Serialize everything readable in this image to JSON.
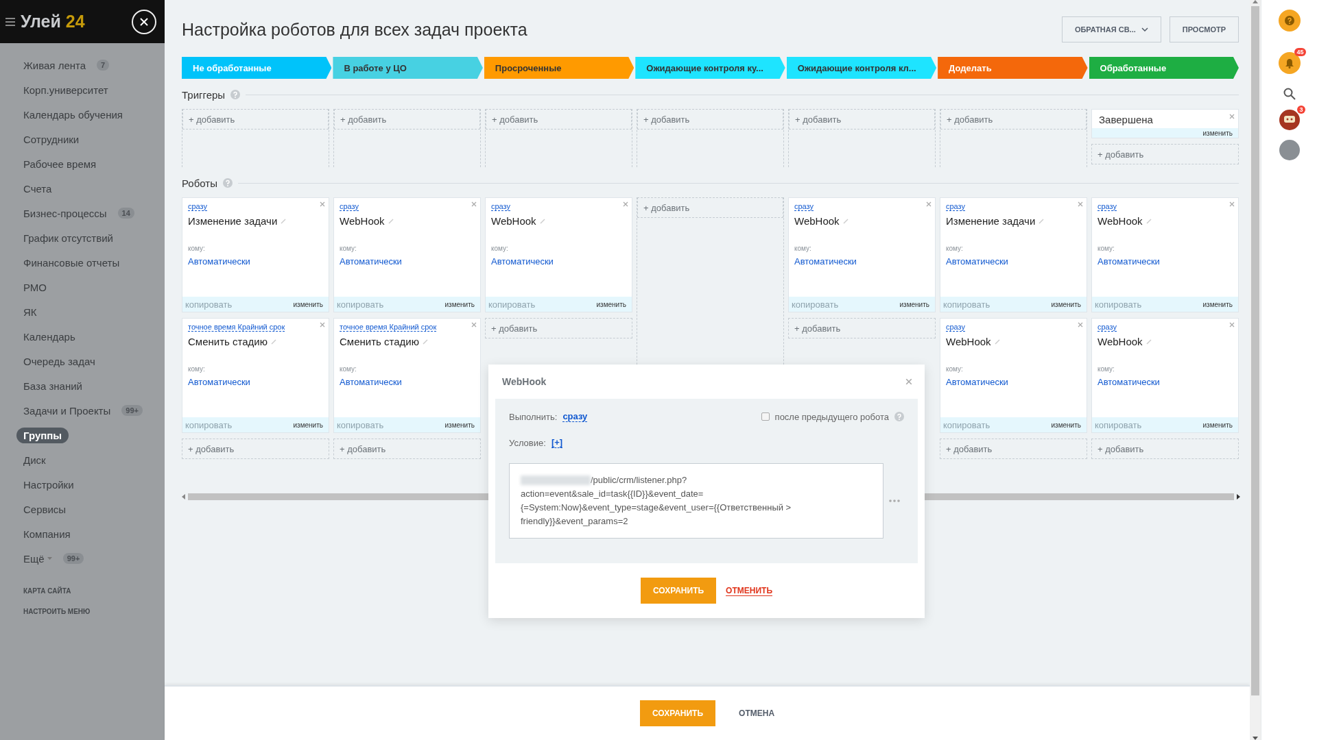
{
  "header": {
    "logo_text": "Улей",
    "logo_number": "24"
  },
  "sidebar": {
    "items": [
      {
        "label": "Живая лента",
        "count": "7",
        "selected": false,
        "dropdown": false
      },
      {
        "label": "Корп.университет",
        "selected": false,
        "dropdown": false
      },
      {
        "label": "Календарь обучения",
        "selected": false,
        "dropdown": false
      },
      {
        "label": "Сотрудники",
        "selected": false,
        "dropdown": false
      },
      {
        "label": "Рабочее время",
        "selected": false,
        "dropdown": false
      },
      {
        "label": "Счета",
        "selected": false,
        "dropdown": false
      },
      {
        "label": "Бизнес-процессы",
        "count": "14",
        "selected": false,
        "dropdown": false
      },
      {
        "label": "График отсутствий",
        "selected": false,
        "dropdown": false
      },
      {
        "label": "Финансовые отчеты",
        "selected": false,
        "dropdown": false
      },
      {
        "label": "РМО",
        "selected": false,
        "dropdown": false
      },
      {
        "label": "ЯК",
        "selected": false,
        "dropdown": false
      },
      {
        "label": "Календарь",
        "selected": false,
        "dropdown": false
      },
      {
        "label": "Очередь задач",
        "selected": false,
        "dropdown": false
      },
      {
        "label": "База знаний",
        "selected": false,
        "dropdown": false
      },
      {
        "label": "Задачи и Проекты",
        "count": "99+",
        "selected": false,
        "dropdown": false
      },
      {
        "label": "Группы",
        "selected": true,
        "dropdown": false
      },
      {
        "label": "Диск",
        "selected": false,
        "dropdown": false
      },
      {
        "label": "Настройки",
        "selected": false,
        "dropdown": false
      },
      {
        "label": "Сервисы",
        "selected": false,
        "dropdown": false
      },
      {
        "label": "Компания",
        "selected": false,
        "dropdown": false
      },
      {
        "label": "Ещё",
        "count": "99+",
        "selected": false,
        "dropdown": true
      }
    ],
    "links": [
      "КАРТА САЙТА",
      "НАСТРОИТЬ МЕНЮ"
    ]
  },
  "page_title": "Настройка роботов для всех задач проекта",
  "header_buttons": [
    {
      "label": "ОБРАТНАЯ СВ...",
      "kind": "dropdown"
    },
    {
      "label": "ПРОСМОТР",
      "kind": "plain"
    }
  ],
  "stages": [
    {
      "label": "Не обработанные",
      "color": "#00c3fa"
    },
    {
      "label": "В работе у ЦО",
      "color": "#47d1e2"
    },
    {
      "label": "Просроченные",
      "color": "#ff9a00"
    },
    {
      "label": "Ожидающие контроля ку...",
      "color": "#1ee4ff"
    },
    {
      "label": "Ожидающие контроля кл...",
      "color": "#1ee4ff"
    },
    {
      "label": "Доделать",
      "color": "#f4680b"
    },
    {
      "label": "Обработанные",
      "color": "#1eae43"
    }
  ],
  "triggers": {
    "title": "Триггеры",
    "columns": [
      {
        "add_label": "+ добавить"
      },
      {
        "add_label": "+ добавить"
      },
      {
        "add_label": "+ добавить"
      },
      {
        "add_label": "+ добавить"
      },
      {
        "add_label": "+ добавить"
      },
      {
        "add_label": "+ добавить"
      },
      {
        "triggers": [
          {
            "name": "Завершена",
            "edit_label": "изменить"
          }
        ],
        "add_label": "+ добавить"
      }
    ]
  },
  "robots": {
    "title": "Роботы",
    "columns": [
      {
        "robots": [
          {
            "when": "сразу",
            "name": "Изменение задачи",
            "to_label": "кому:",
            "to": "Автоматически",
            "copy_label": "копировать",
            "edit_label": "изменить"
          },
          {
            "when": "точное время Крайний срок",
            "name": "Сменить стадию",
            "to_label": "кому:",
            "to": "Автоматически",
            "copy_label": "копировать",
            "edit_label": "изменить"
          }
        ],
        "add_label": "+ добавить"
      },
      {
        "robots": [
          {
            "when": "сразу",
            "name": "WebHook",
            "to_label": "кому:",
            "to": "Автоматически",
            "copy_label": "копировать",
            "edit_label": "изменить"
          },
          {
            "when": "точное время Крайний срок",
            "name": "Сменить стадию",
            "to_label": "кому:",
            "to": "Автоматически",
            "copy_label": "копировать",
            "edit_label": "изменить"
          }
        ],
        "add_label": "+ добавить"
      },
      {
        "robots": [
          {
            "when": "сразу",
            "name": "WebHook",
            "to_label": "кому:",
            "to": "Автоматически",
            "copy_label": "копировать",
            "edit_label": "изменить"
          }
        ],
        "add_label": "+ добавить"
      },
      {
        "add_label": "+ добавить"
      },
      {
        "robots": [
          {
            "when": "сразу",
            "name": "WebHook",
            "to_label": "кому:",
            "to": "Автоматически",
            "copy_label": "копировать",
            "edit_label": "изменить"
          }
        ],
        "add_label": "+ добавить"
      },
      {
        "robots": [
          {
            "when": "сразу",
            "name": "Изменение задачи",
            "to_label": "кому:",
            "to": "Автоматически",
            "copy_label": "копировать",
            "edit_label": "изменить"
          },
          {
            "when": "сразу",
            "name": "WebHook",
            "to_label": "кому:",
            "to": "Автоматически",
            "copy_label": "копировать",
            "edit_label": "изменить"
          }
        ],
        "add_label": "+ добавить"
      },
      {
        "robots": [
          {
            "when": "сразу",
            "name": "WebHook",
            "to_label": "кому:",
            "to": "Автоматически",
            "copy_label": "копировать",
            "edit_label": "изменить"
          },
          {
            "when": "сразу",
            "name": "WebHook",
            "to_label": "кому:",
            "to": "Автоматически",
            "copy_label": "копировать",
            "edit_label": "изменить"
          }
        ],
        "add_label": "+ добавить"
      }
    ]
  },
  "modal": {
    "title": "WebHook",
    "run_label": "Выполнить:",
    "run_value": "сразу",
    "after_previous": {
      "label": "после предыдущего робота",
      "checked": false
    },
    "condition_label": "Условие:",
    "condition_value": "[+]",
    "url_lines": [
      "/public/crm/listener.php?",
      "action=event&sale_id=task{{ID}}&event_date=",
      "{=System:Now}&event_type=stage&event_user={{Ответственный >",
      "friendly}}&event_params=2"
    ],
    "save_label": "СОХРАНИТЬ",
    "cancel_label": "ОТМЕНИТЬ"
  },
  "footer": {
    "save_label": "СОХРАНИТЬ",
    "cancel_label": "ОТМЕНА"
  },
  "right_bar": {
    "notifications_count": "45",
    "chat_count": "3"
  }
}
